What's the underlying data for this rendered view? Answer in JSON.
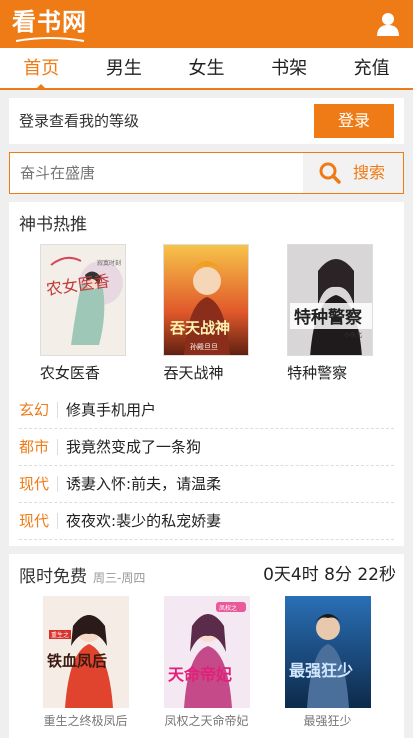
{
  "header": {
    "logo_text": "看书网",
    "brand_color": "#ef7b16",
    "user_icon": "user-icon"
  },
  "nav": {
    "items": [
      {
        "label": "首页",
        "active": true
      },
      {
        "label": "男生",
        "active": false
      },
      {
        "label": "女生",
        "active": false
      },
      {
        "label": "书架",
        "active": false
      },
      {
        "label": "充值",
        "active": false
      }
    ]
  },
  "login": {
    "prompt": "登录查看我的等级",
    "button_label": "登录"
  },
  "search": {
    "placeholder": "奋斗在盛唐",
    "button_label": "搜索",
    "icon": "search-icon"
  },
  "hot": {
    "title": "神书热推",
    "books": [
      {
        "name": "农女医香",
        "cover_text": "农女医香",
        "cover_sub": "寂寞时刻"
      },
      {
        "name": "吞天战神",
        "cover_text": "吞天战神",
        "cover_sub": "孙殿旦旦"
      },
      {
        "name": "特种警察",
        "cover_text": "特种警察",
        "cover_sub": "小东北"
      }
    ],
    "list": [
      {
        "tag": "玄幻",
        "title": "修真手机用户"
      },
      {
        "tag": "都市",
        "title": "我竟然变成了一条狗"
      },
      {
        "tag": "现代",
        "title": "诱妻入怀:前夫，请温柔"
      },
      {
        "tag": "现代",
        "title": "夜夜欢:裴少的私宠娇妻"
      }
    ]
  },
  "free": {
    "title": "限时免费",
    "subtitle": "周三-周四",
    "countdown": "0天4时 8分 22秒",
    "books": [
      {
        "name": "重生之终极凤后",
        "cover_text": "铁血凤后",
        "cover_badge": "重生之"
      },
      {
        "name": "凤权之天命帝妃",
        "cover_text": "天命帝妃",
        "cover_badge": "凤权之"
      },
      {
        "name": "最强狂少",
        "cover_text": "最强狂少",
        "cover_badge": ""
      }
    ]
  }
}
